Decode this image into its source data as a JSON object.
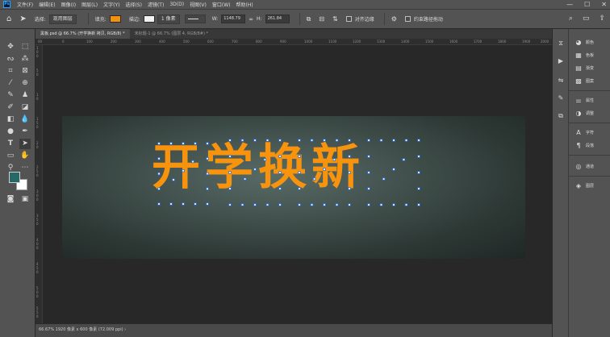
{
  "menubar": {
    "logo": "Ps",
    "items": [
      "文件(F)",
      "编辑(E)",
      "图像(I)",
      "图层(L)",
      "文字(Y)",
      "选择(S)",
      "滤镜(T)",
      "3D(D)",
      "视图(V)",
      "窗口(W)",
      "帮助(H)"
    ],
    "window_controls": [
      "—",
      "☐",
      "✕"
    ]
  },
  "options": {
    "select_label": "选择:",
    "select_value": "现用图层",
    "fill_label": "填充:",
    "stroke_label": "描边:",
    "stroke_width": "1 像素",
    "w_label": "W:",
    "w_value": "1148.79",
    "h_label": "H:",
    "h_value": "261.84",
    "align_edges": "对齐边缘",
    "constrain_path": "约束路径拖动",
    "fill_color": "#f0930a"
  },
  "tabs": [
    {
      "label": "黑板.psd @ 66.7% (开学换新 拷贝, RGB/8) *"
    },
    {
      "label": "未标题-1 @ 66.7% (图层 4, RGB/8#) *"
    }
  ],
  "rulers": {
    "h": [
      "00",
      "0",
      "100",
      "200",
      "300",
      "400",
      "500",
      "600",
      "700",
      "800",
      "900",
      "1000",
      "1100",
      "1200",
      "1300",
      "1400",
      "1500",
      "1600",
      "1700",
      "1800",
      "1900",
      "2000"
    ],
    "v": [
      "1",
      "0",
      "0",
      "5",
      "0",
      "1",
      "0",
      "1",
      "5",
      "0",
      "2",
      "0",
      "2",
      "5",
      "0",
      "3",
      "0",
      "0",
      "3",
      "5",
      "0",
      "4",
      "0",
      "0",
      "4",
      "5",
      "0",
      "5",
      "0",
      "0",
      "5",
      "5",
      "0",
      "6",
      "0",
      "0"
    ]
  },
  "canvas": {
    "text": "开学换新",
    "text_color": "#f7930c",
    "board_color": "#43524e"
  },
  "status": {
    "text": "66.67%    1920 像素 x 600 像素 (72.009 ppi)  ›"
  },
  "panels": {
    "group1": [
      {
        "icon": "palette-icon",
        "label": "颜色"
      },
      {
        "icon": "swatches-icon",
        "label": "色板"
      },
      {
        "icon": "gradient-icon",
        "label": "渐变"
      },
      {
        "icon": "pattern-icon",
        "label": "图案"
      }
    ],
    "group2": [
      {
        "icon": "properties-icon",
        "label": "属性"
      },
      {
        "icon": "adjustments-icon",
        "label": "调整"
      }
    ],
    "group3": [
      {
        "icon": "character-icon",
        "label": "字符"
      },
      {
        "icon": "paragraph-icon",
        "label": "段落"
      }
    ],
    "group4": [
      {
        "icon": "channels-icon",
        "label": "通道"
      }
    ],
    "group5": [
      {
        "icon": "layers-icon",
        "label": "图层"
      }
    ]
  }
}
